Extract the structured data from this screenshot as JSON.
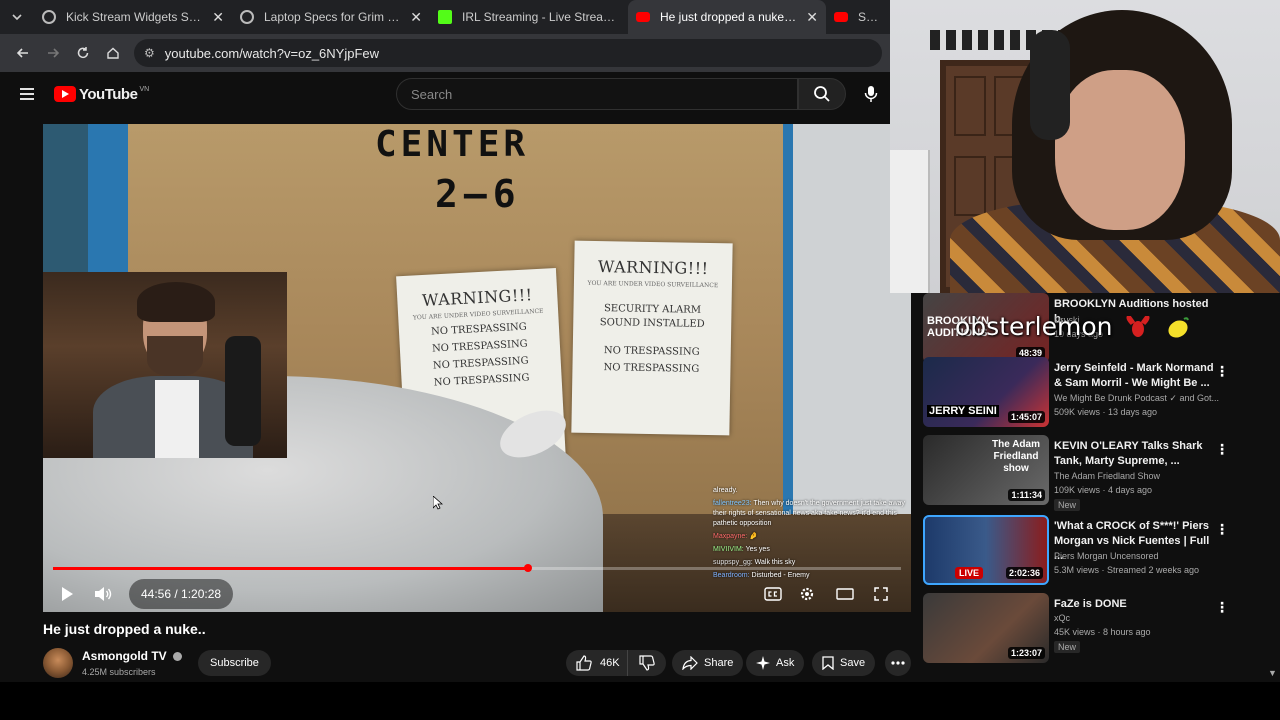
{
  "browser": {
    "tabs": [
      {
        "title": "Kick Stream Widgets Setup",
        "icon": "globe-icon"
      },
      {
        "title": "Laptop Specs for Grim Dawn",
        "icon": "globe-icon"
      },
      {
        "title": "IRL Streaming - Live Streams o",
        "icon": "kick-icon"
      },
      {
        "title": "He just dropped a nuke.. - YouT",
        "icon": "youtube-icon",
        "active": true
      },
      {
        "title": "SomeOr",
        "icon": "youtube-icon"
      }
    ],
    "url": "youtube.com/watch?v=oz_6NYjpFew"
  },
  "youtube": {
    "logo_text": "YouTube",
    "region": "VN",
    "search_placeholder": "Search"
  },
  "player": {
    "time": "44:56 / 1:20:28",
    "progress": 0.56,
    "signs": {
      "center": "CENTER",
      "number": "2—6"
    },
    "paper1": {
      "heading": "WARNING!!!",
      "sub": "YOU ARE UNDER VIDEO SURVEILLANCE",
      "lines": [
        "NO TRESPASSING",
        "NO TRESPASSING",
        "NO TRESPASSING",
        "NO TRESPASSING"
      ]
    },
    "paper2": {
      "heading": "WARNING!!!",
      "sub": "YOU ARE UNDER VIDEO SURVEILLANCE",
      "alarm": "SECURITY ALARM SOUND INSTALLED",
      "lines": [
        "NO TRESPASSING",
        "NO TRESPASSING"
      ]
    },
    "chat": [
      {
        "user": "",
        "text": "already."
      },
      {
        "user": "fallentree23:",
        "text": "Then why doesn't the government just take away their rights of sensational news aka fake news? it'd end this pathetic opposition"
      },
      {
        "user": "Maxpayne:",
        "text": "🤌"
      },
      {
        "user": "MIVIIVIM:",
        "text": "Yes yes"
      },
      {
        "user": "suppspy_gg:",
        "text": "Walk this sky"
      },
      {
        "user": "Beardroom:",
        "text": "Disturbed - Enemy"
      }
    ]
  },
  "video": {
    "title": "He just dropped a nuke..",
    "channel": "Asmongold TV",
    "subscribers": "4.25M subscribers",
    "subscribe_label": "Subscribe",
    "likes": "46K",
    "share_label": "Share",
    "ask_label": "Ask",
    "save_label": "Save"
  },
  "overlay": {
    "streamer_name": "obsterlemon"
  },
  "recommendations": [
    {
      "title": "BROOKLYN Auditions hosted b...",
      "channel": "Druski",
      "meta": "10 days ago",
      "duration": "48:39",
      "thumb_text": "BROOKLYN AUDITIONS",
      "colors": [
        "#3a3a3a",
        "#a33"
      ]
    },
    {
      "title": "Jerry Seinfeld - Mark Normand & Sam Morril - We Might Be ...",
      "channel": "We Might Be Drunk Podcast",
      "channel_suffix": "and Got...",
      "meta": "509K views · 13 days ago",
      "duration": "1:45:07",
      "thumb_text": "JERRY SEINI",
      "colors": [
        "#1b2a4a",
        "#c33"
      ]
    },
    {
      "title": "KEVIN O'LEARY Talks Shark Tank, Marty Supreme, ...",
      "channel": "The Adam Friedland Show",
      "meta": "109K views · 4 days ago",
      "duration": "1:11:34",
      "badge": "New",
      "thumb_text": "The Adam Friedland show",
      "colors": [
        "#2a2a2a",
        "#555"
      ]
    },
    {
      "title": "'What a CROCK of S***!' Piers Morgan vs Nick Fuentes | Full ...",
      "channel": "Piers Morgan Uncensored",
      "meta": "5.3M views · Streamed 2 weeks ago",
      "duration": "2:02:36",
      "live_label": "LIVE",
      "colors": [
        "#1d3a6a",
        "#8a1d1d"
      ]
    },
    {
      "title": "FaZe is DONE",
      "channel": "xQc",
      "meta": "45K views · 8 hours ago",
      "duration": "1:23:07",
      "badge": "New",
      "colors": [
        "#3a3a3a",
        "#6a4a3a"
      ]
    }
  ]
}
